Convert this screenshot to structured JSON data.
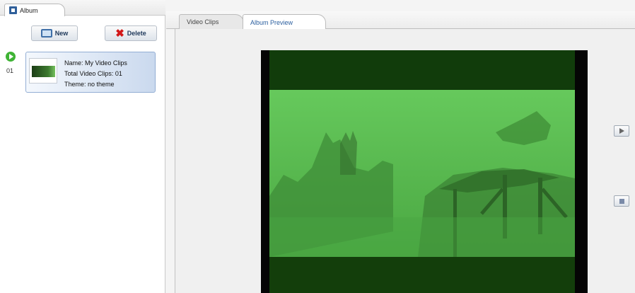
{
  "left_panel": {
    "tab_label": "Album",
    "new_button": "New",
    "delete_button": "Delete",
    "album_item": {
      "index": "01",
      "name": "Name: My Video Clips",
      "total": "Total Video Clips: 01",
      "theme": "Theme: no theme"
    }
  },
  "right_panel": {
    "tabs": [
      {
        "label": "Video Clips",
        "active": false
      },
      {
        "label": "Album Preview",
        "active": true
      }
    ]
  },
  "icons": {
    "album_tab": "album-icon",
    "new": "monitor-icon",
    "delete": "x-icon",
    "play_marker": "play-circle-icon",
    "play_control": "play-icon",
    "stop_control": "stop-icon"
  },
  "colors": {
    "preview_tint": "#52b84a",
    "letterbox": "#113c0b",
    "selection": "#cad9ee",
    "delete_red": "#d21818",
    "play_green": "#3fb335"
  }
}
